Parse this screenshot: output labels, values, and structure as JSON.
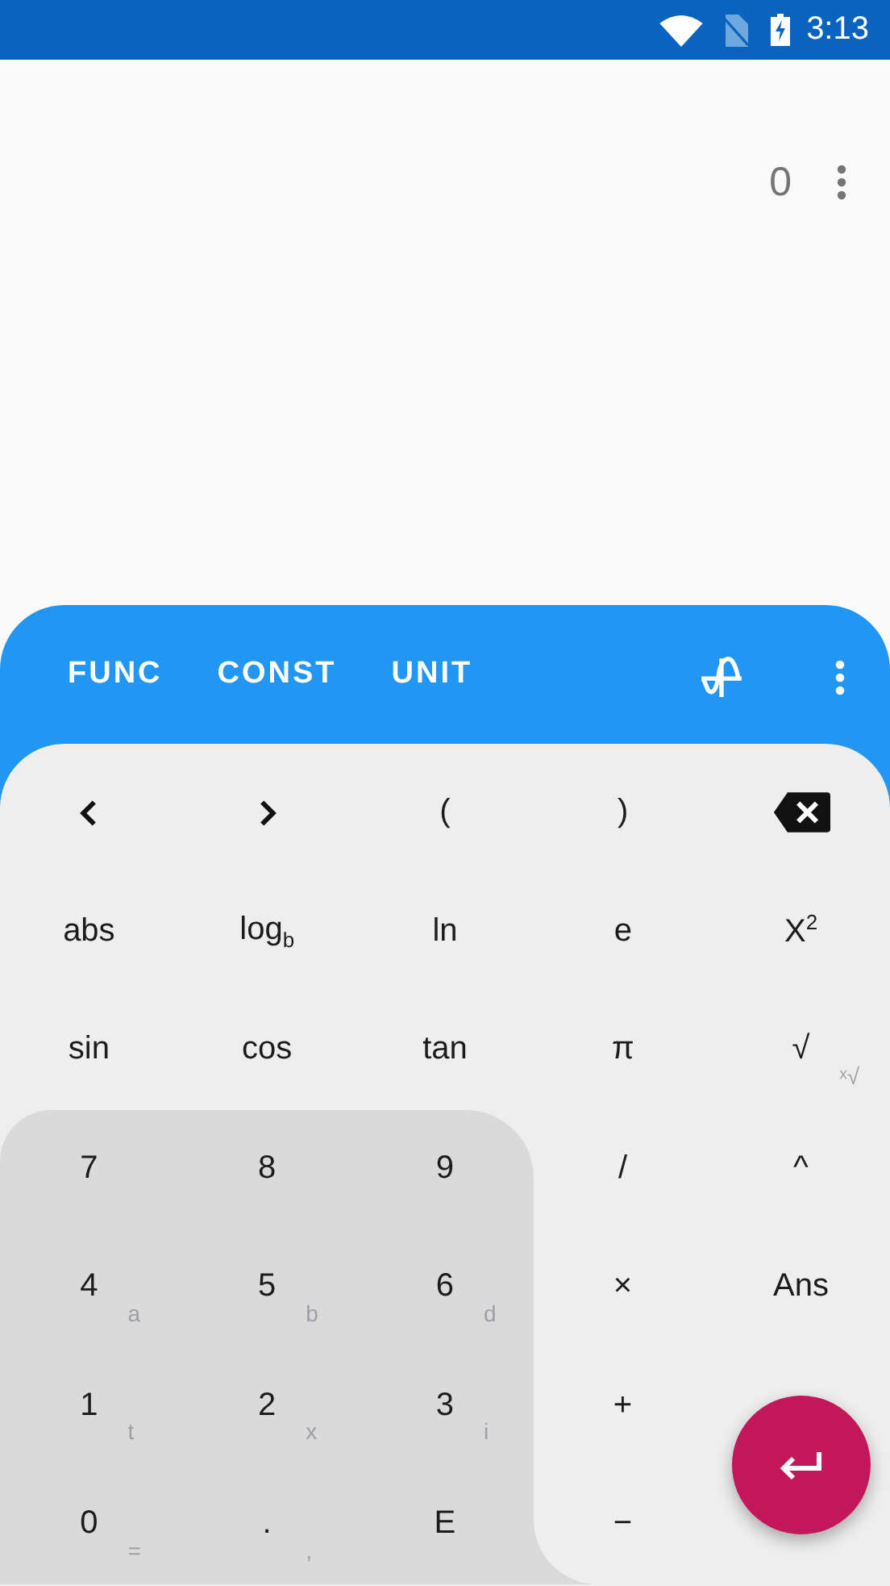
{
  "status_bar": {
    "time": "3:13"
  },
  "display": {
    "value": "0"
  },
  "toolbar": {
    "tabs": [
      {
        "label": "FUNC"
      },
      {
        "label": "CONST"
      },
      {
        "label": "UNIT"
      }
    ]
  },
  "keypad": {
    "rows": [
      [
        {
          "kind": "left"
        },
        {
          "kind": "right"
        },
        {
          "kind": "text",
          "label": "("
        },
        {
          "kind": "text",
          "label": ")"
        },
        {
          "kind": "backspace"
        }
      ],
      [
        {
          "kind": "text",
          "label": "abs"
        },
        {
          "kind": "text",
          "label": "log$_{b}$"
        },
        {
          "kind": "text",
          "label": "ln"
        },
        {
          "kind": "text",
          "label": "e"
        },
        {
          "kind": "text",
          "label": "X$^{2}$"
        }
      ],
      [
        {
          "kind": "text",
          "label": "sin"
        },
        {
          "kind": "text",
          "label": "cos"
        },
        {
          "kind": "text",
          "label": "tan"
        },
        {
          "kind": "text",
          "label": "π"
        },
        {
          "kind": "text",
          "label": "√",
          "secondary": "ˣ√"
        }
      ],
      [
        {
          "kind": "text",
          "label": "7"
        },
        {
          "kind": "text",
          "label": "8"
        },
        {
          "kind": "text",
          "label": "9"
        },
        {
          "kind": "text",
          "label": "/"
        },
        {
          "kind": "text",
          "label": "^"
        }
      ],
      [
        {
          "kind": "text",
          "label": "4",
          "secondary": "a"
        },
        {
          "kind": "text",
          "label": "5",
          "secondary": "b"
        },
        {
          "kind": "text",
          "label": "6",
          "secondary": "d"
        },
        {
          "kind": "text",
          "label": "×"
        },
        {
          "kind": "text",
          "label": "Ans"
        }
      ],
      [
        {
          "kind": "text",
          "label": "1",
          "secondary": "t"
        },
        {
          "kind": "text",
          "label": "2",
          "secondary": "x"
        },
        {
          "kind": "text",
          "label": "3",
          "secondary": "i"
        },
        {
          "kind": "text",
          "label": "+"
        }
      ],
      [
        {
          "kind": "text",
          "label": "0",
          "secondary": "="
        },
        {
          "kind": "text",
          "label": ".",
          "secondary": ","
        },
        {
          "kind": "text",
          "label": "E"
        },
        {
          "kind": "text",
          "label": "−"
        }
      ]
    ]
  }
}
